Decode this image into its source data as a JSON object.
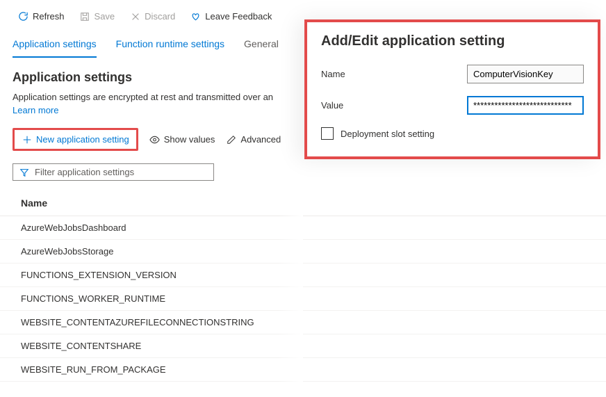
{
  "toolbar": {
    "refresh": "Refresh",
    "save": "Save",
    "discard": "Discard",
    "feedback": "Leave Feedback"
  },
  "tabs": {
    "app_settings": "Application settings",
    "runtime": "Function runtime settings",
    "general": "General"
  },
  "section": {
    "heading": "Application settings",
    "description": "Application settings are encrypted at rest and transmitted over an",
    "learn_more": "Learn more"
  },
  "actions": {
    "new": "New application setting",
    "show_values": "Show values",
    "advanced": "Advanced"
  },
  "filter_placeholder": "Filter application settings",
  "table": {
    "header_name": "Name",
    "rows": [
      "AzureWebJobsDashboard",
      "AzureWebJobsStorage",
      "FUNCTIONS_EXTENSION_VERSION",
      "FUNCTIONS_WORKER_RUNTIME",
      "WEBSITE_CONTENTAZUREFILECONNECTIONSTRING",
      "WEBSITE_CONTENTSHARE",
      "WEBSITE_RUN_FROM_PACKAGE"
    ]
  },
  "panel": {
    "title": "Add/Edit application setting",
    "name_label": "Name",
    "name_value": "ComputerVisionKey",
    "value_label": "Value",
    "value_value": "****************************",
    "slot_label": "Deployment slot setting"
  }
}
